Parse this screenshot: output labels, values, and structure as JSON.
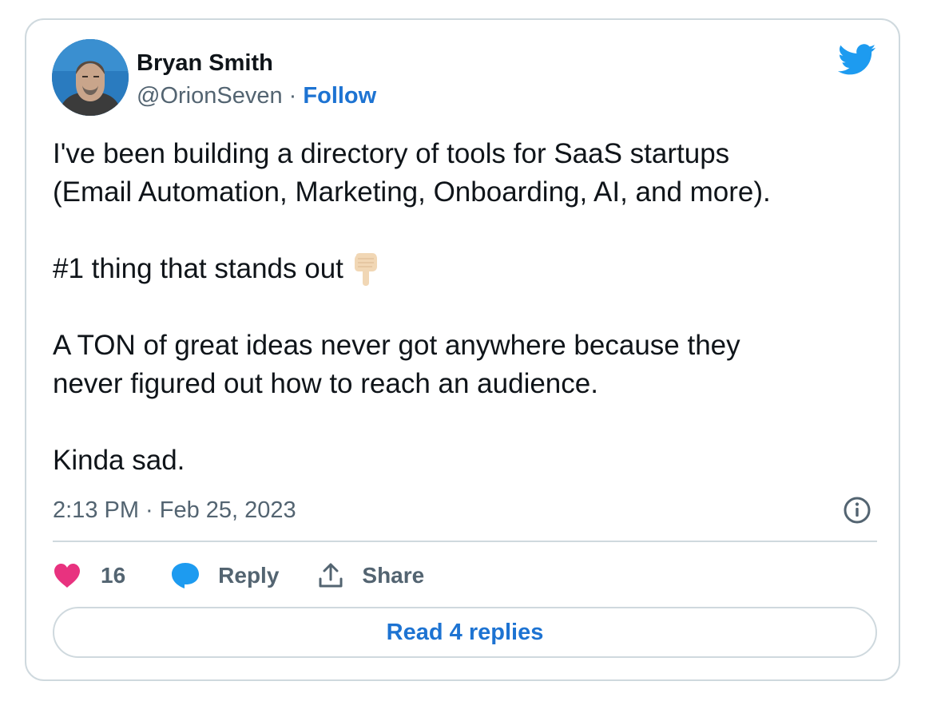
{
  "author": {
    "name": "Bryan Smith",
    "handle": "@OrionSeven",
    "separator": "·",
    "follow_label": "Follow"
  },
  "tweet": {
    "lines": [
      "I've been building a directory of tools for SaaS startups",
      "(Email Automation, Marketing, Onboarding, AI, and more).",
      "#1 thing that stands out",
      "A TON of great ideas never got anywhere because they",
      "never figured out how to reach an audience.",
      "Kinda sad."
    ],
    "emoji": "backhand-index-pointing-down"
  },
  "meta": {
    "timestamp": "2:13 PM · Feb 25, 2023"
  },
  "actions": {
    "likes_count": "16",
    "reply_label": "Reply",
    "share_label": "Share"
  },
  "read_replies_label": "Read 4 replies",
  "colors": {
    "accent": "#1d73d2",
    "twitter_blue": "#1d9bf0",
    "like_pink": "#f91880",
    "muted_text": "#536471",
    "border": "#cfd9de"
  }
}
